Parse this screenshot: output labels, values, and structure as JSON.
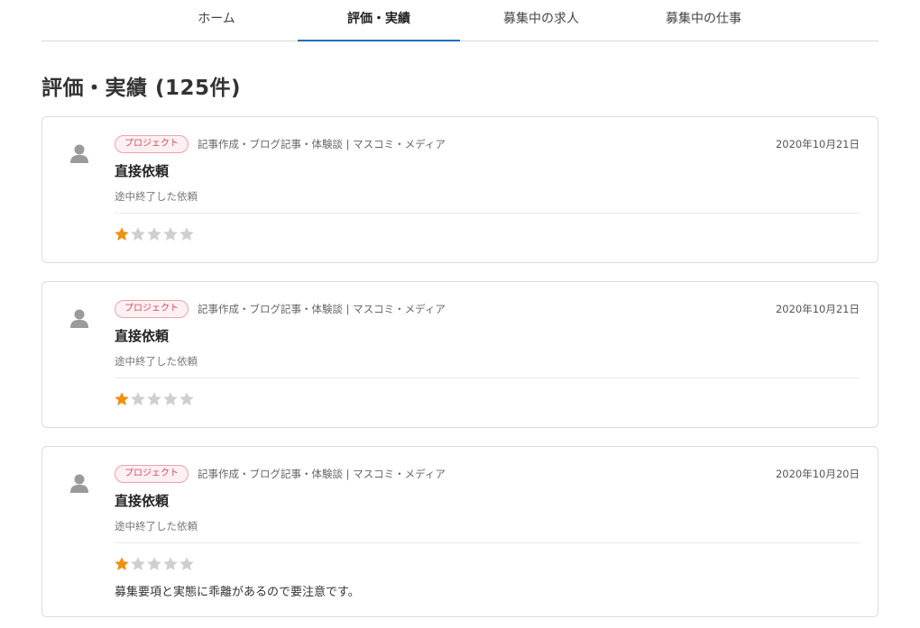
{
  "nav": {
    "tabs": [
      {
        "label": "ホーム",
        "active": false
      },
      {
        "label": "評価・実績",
        "active": true
      },
      {
        "label": "募集中の求人",
        "active": false
      },
      {
        "label": "募集中の仕事",
        "active": false
      }
    ]
  },
  "page": {
    "title": "評価・実績 (125件)"
  },
  "colors": {
    "accent": "#1f6fb8",
    "tag_border": "#e9a3ad",
    "tag_text": "#d0485d",
    "star_filled": "#f0900f",
    "star_empty": "#cfcfcf",
    "avatar": "#9a9a9a"
  },
  "icons": {
    "avatar": "user-icon",
    "star": "star-icon"
  },
  "reviews": [
    {
      "tag": "プロジェクト",
      "category": "記事作成・ブログ記事・体験談 | マスコミ・メディア",
      "date": "2020年10月21日",
      "title": "直接依頼",
      "status": "途中終了した依頼",
      "rating": 1,
      "max_rating": 5,
      "comment": ""
    },
    {
      "tag": "プロジェクト",
      "category": "記事作成・ブログ記事・体験談 | マスコミ・メディア",
      "date": "2020年10月21日",
      "title": "直接依頼",
      "status": "途中終了した依頼",
      "rating": 1,
      "max_rating": 5,
      "comment": ""
    },
    {
      "tag": "プロジェクト",
      "category": "記事作成・ブログ記事・体験談 | マスコミ・メディア",
      "date": "2020年10月20日",
      "title": "直接依頼",
      "status": "途中終了した依頼",
      "rating": 1,
      "max_rating": 5,
      "comment": "募集要項と実態に乖離があるので要注意です。"
    }
  ]
}
